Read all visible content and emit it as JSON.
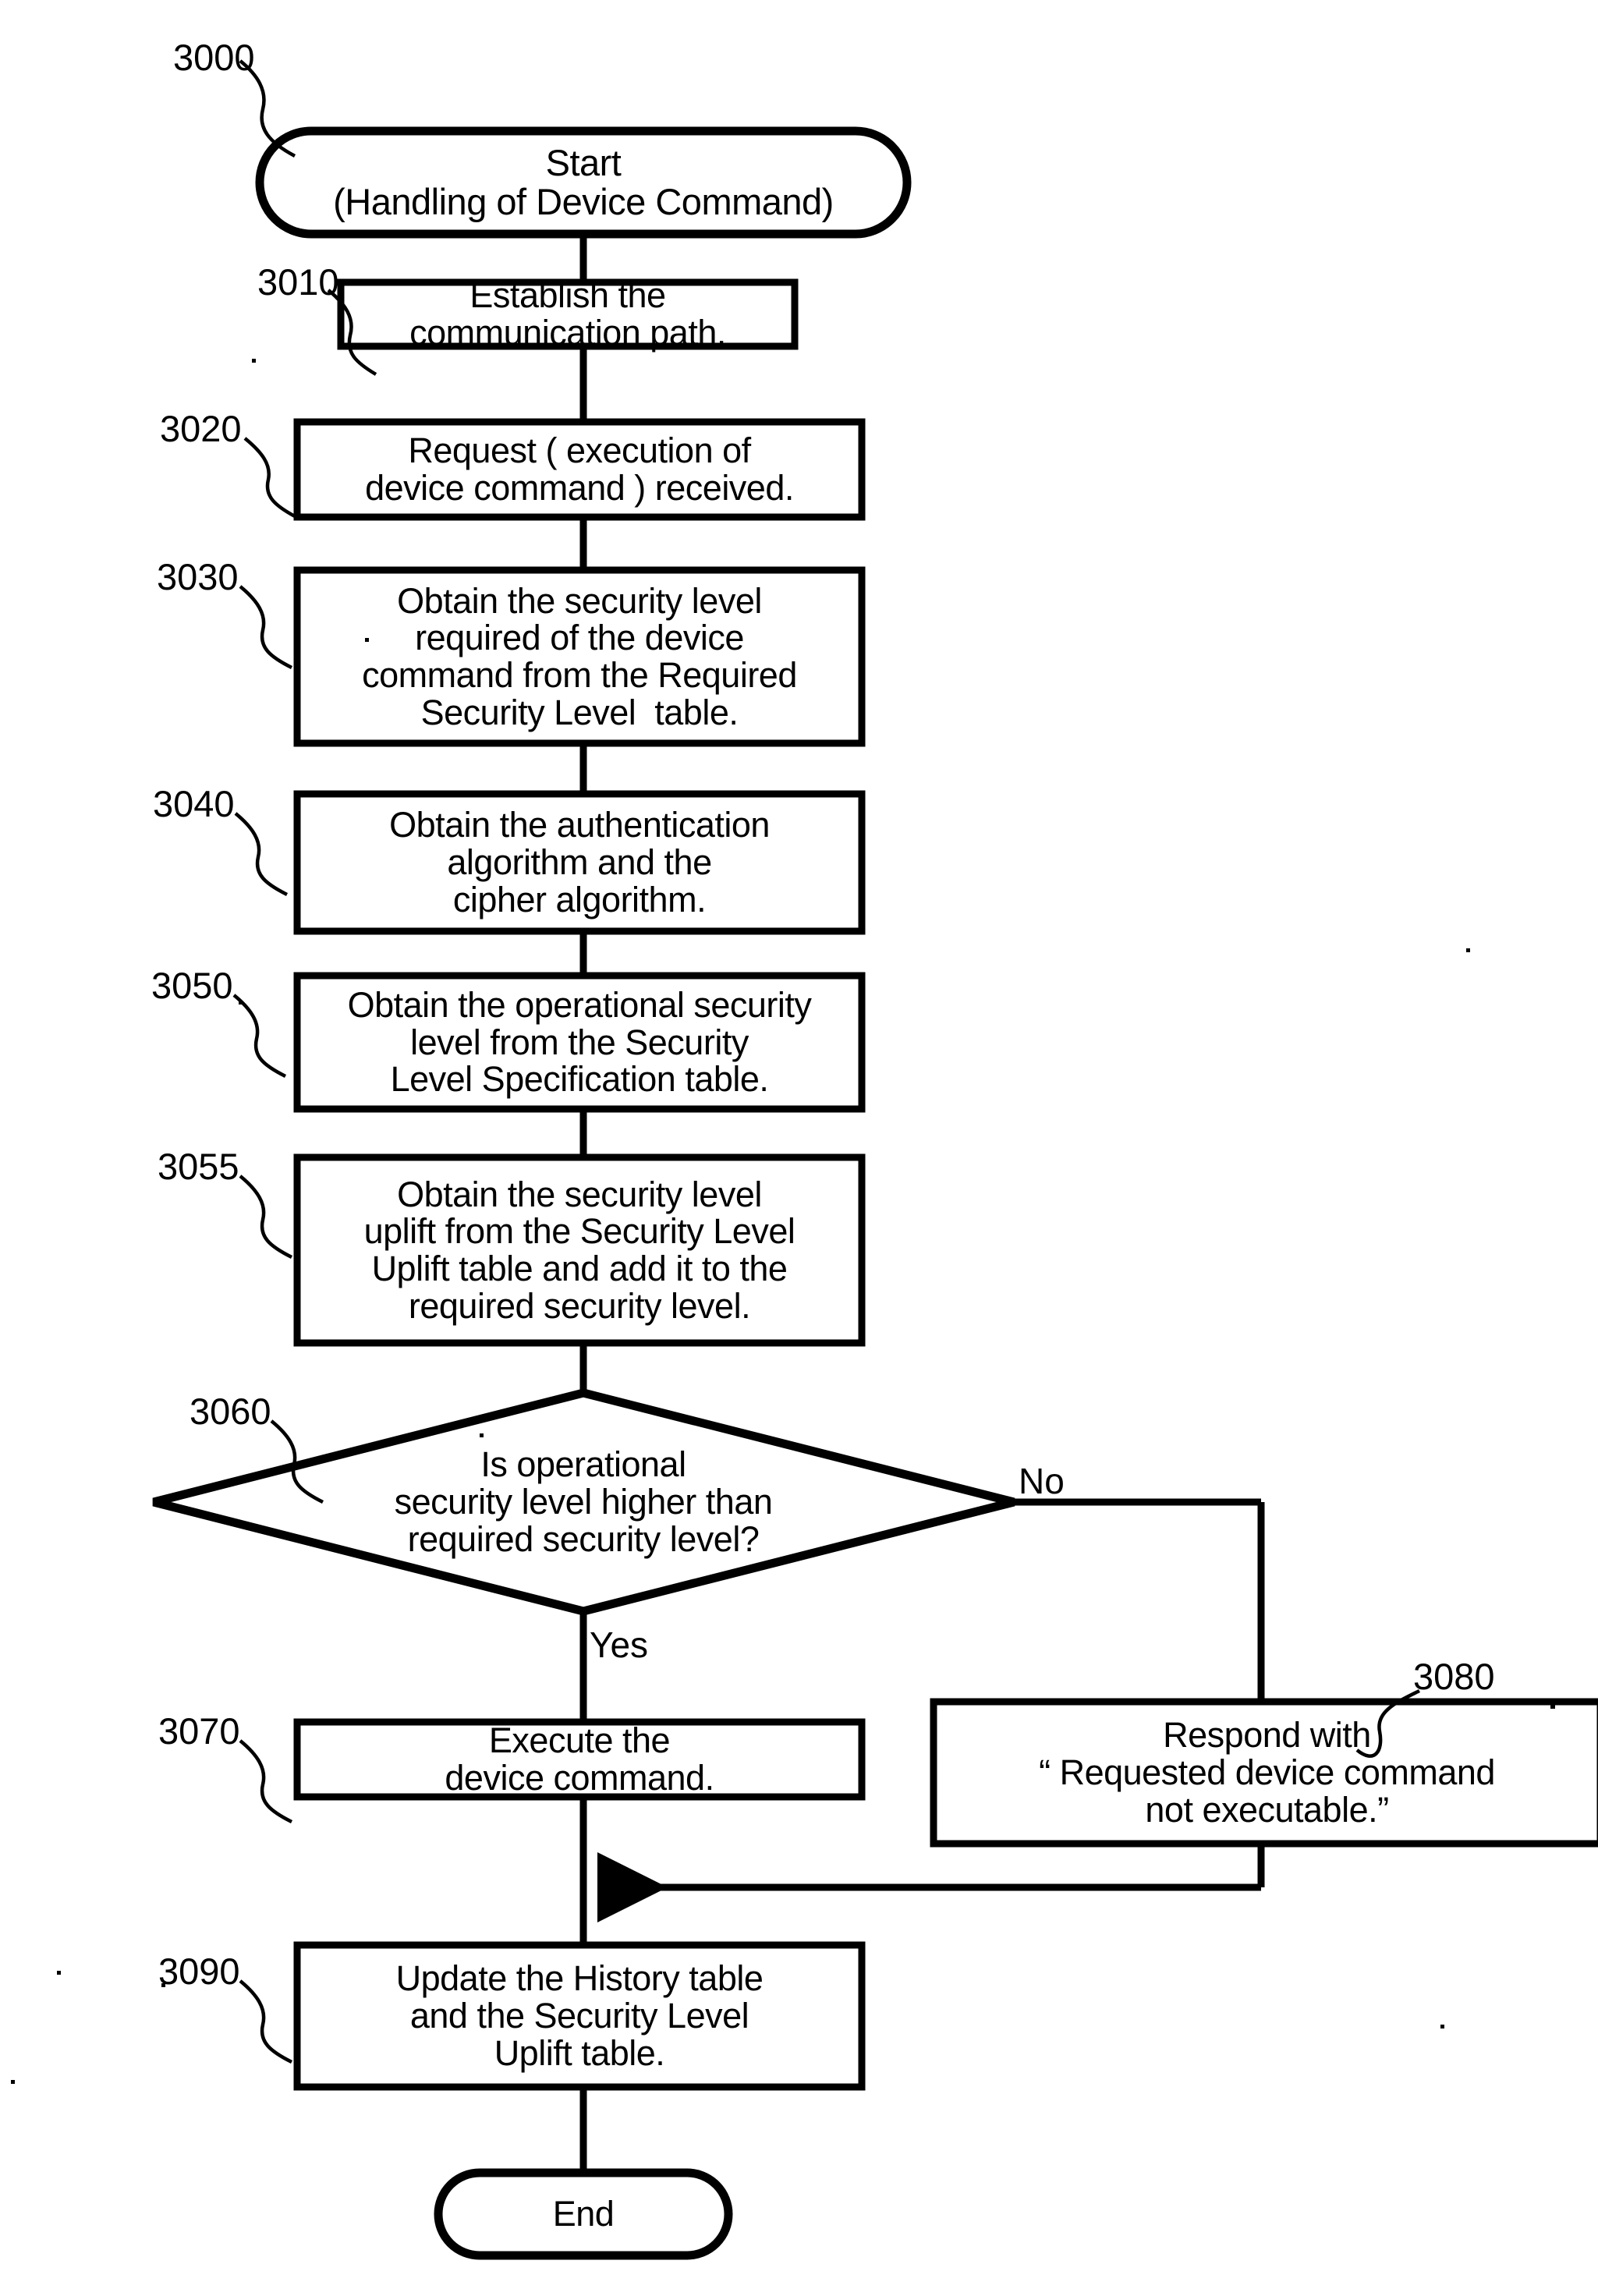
{
  "figure": {
    "type": "flowchart",
    "title": "Handling of Device Command",
    "orientation": "vertical",
    "line_color": "#000000",
    "background_color": "#ffffff"
  },
  "nodes": {
    "start": {
      "ref": "3000",
      "shape": "terminator",
      "lines": [
        "Start",
        "(Handling of Device Command)"
      ]
    },
    "step_3010": {
      "ref": "3010",
      "shape": "process",
      "lines": [
        "Establish the",
        "communication path."
      ]
    },
    "step_3020": {
      "ref": "3020",
      "shape": "process",
      "lines": [
        "Request ( execution of",
        "device command ) received."
      ]
    },
    "step_3030": {
      "ref": "3030",
      "shape": "process",
      "lines": [
        "Obtain the security level",
        "required of the device",
        "command from the Required",
        "Security Level  table."
      ]
    },
    "step_3040": {
      "ref": "3040",
      "shape": "process",
      "lines": [
        "Obtain the authentication",
        "algorithm and the",
        "cipher algorithm."
      ]
    },
    "step_3050": {
      "ref": "3050",
      "shape": "process",
      "lines": [
        "Obtain the operational security",
        "level from the Security",
        "Level Specification table."
      ]
    },
    "step_3055": {
      "ref": "3055",
      "shape": "process",
      "lines": [
        "Obtain the security level",
        "uplift from the Security Level",
        "Uplift table and add it to the",
        "required security level."
      ]
    },
    "decision_3060": {
      "ref": "3060",
      "shape": "decision",
      "lines": [
        "Is operational",
        "security level higher than",
        "required security level?"
      ],
      "branch_yes": "Yes",
      "branch_no": "No"
    },
    "step_3070": {
      "ref": "3070",
      "shape": "process",
      "lines": [
        "Execute the",
        "device command."
      ]
    },
    "step_3080": {
      "ref": "3080",
      "shape": "process",
      "lines": [
        "Respond with",
        "“ Requested device command",
        "not executable.”"
      ]
    },
    "step_3090": {
      "ref": "3090",
      "shape": "process",
      "lines": [
        "Update the History table",
        "and the Security Level",
        "Uplift table."
      ]
    },
    "end": {
      "ref": "",
      "shape": "terminator",
      "lines": [
        "End"
      ]
    }
  },
  "edges": [
    {
      "from": "start",
      "to": "step_3010",
      "label": ""
    },
    {
      "from": "step_3010",
      "to": "step_3020",
      "label": ""
    },
    {
      "from": "step_3020",
      "to": "step_3030",
      "label": ""
    },
    {
      "from": "step_3030",
      "to": "step_3040",
      "label": ""
    },
    {
      "from": "step_3040",
      "to": "step_3050",
      "label": ""
    },
    {
      "from": "step_3050",
      "to": "step_3055",
      "label": ""
    },
    {
      "from": "step_3055",
      "to": "decision_3060",
      "label": ""
    },
    {
      "from": "decision_3060",
      "to": "step_3070",
      "label": "Yes"
    },
    {
      "from": "decision_3060",
      "to": "step_3080",
      "label": "No"
    },
    {
      "from": "step_3070",
      "to": "step_3090",
      "label": ""
    },
    {
      "from": "step_3080",
      "to": "step_3090",
      "label": ""
    },
    {
      "from": "step_3090",
      "to": "end",
      "label": ""
    }
  ]
}
